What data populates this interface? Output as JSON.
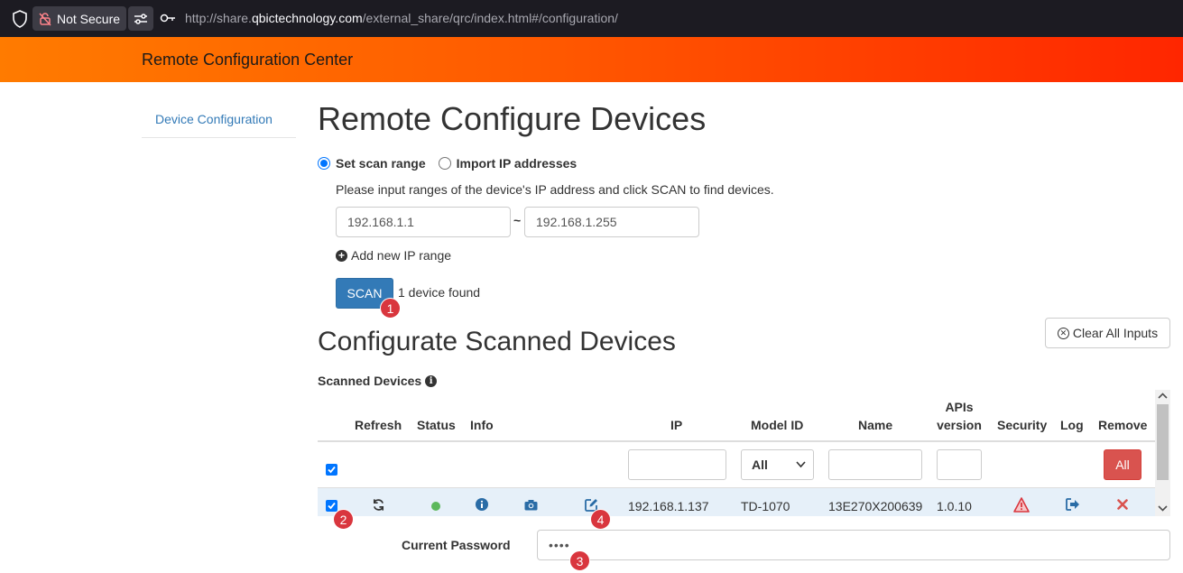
{
  "browser": {
    "not_secure_label": "Not Secure",
    "url_prefix": "http://share.",
    "url_host": "qbictechnology.com",
    "url_path": "/external_share/qrc/index.html#/configuration/"
  },
  "header": {
    "title": "Remote Configuration Center"
  },
  "sidebar": {
    "items": [
      {
        "label": "Device Configuration"
      }
    ]
  },
  "main": {
    "title": "Remote Configure Devices",
    "scan_mode": {
      "options": [
        "Set scan range",
        "Import IP addresses"
      ],
      "selected": "Set scan range"
    },
    "instructions": "Please input ranges of the device's IP address and click SCAN to find devices.",
    "ip_range": {
      "from": "192.168.1.1",
      "separator": "~",
      "to": "192.168.1.255"
    },
    "add_range_label": "Add new IP range",
    "scan_button": "SCAN",
    "scan_result": "1 device found"
  },
  "configure": {
    "title": "Configurate Scanned Devices",
    "clear_button": "Clear All Inputs",
    "scanned_label": "Scanned Devices",
    "table": {
      "headers": {
        "refresh": "Refresh",
        "status": "Status",
        "info": "Info",
        "ip": "IP",
        "model": "Model ID",
        "name": "Name",
        "apis_line1": "APIs",
        "apis_line2": "version",
        "security": "Security",
        "log": "Log",
        "remove": "Remove"
      },
      "filters": {
        "model_selected": "All",
        "remove_all_button": "All"
      },
      "rows": [
        {
          "ip": "192.168.1.137",
          "model": "TD-1070",
          "name": "13E270X200639",
          "api_version": "1.0.10",
          "checked": true,
          "status_color": "#5cb85c"
        }
      ]
    },
    "password": {
      "label": "Current Password",
      "value": "••••"
    }
  },
  "annotations": [
    "1",
    "2",
    "3",
    "4"
  ],
  "colors": {
    "header_gradient_start": "#ff7b00",
    "header_gradient_end": "#ff2600",
    "link": "#337ab7",
    "primary_button": "#337ab7",
    "danger_button": "#d9534f",
    "badge": "#d9363e",
    "row_highlight": "#e6f0f9"
  },
  "icons": [
    "shield-icon",
    "lock-slash-icon",
    "permissions-icon",
    "key-icon",
    "plus-circle-icon",
    "x-circle-icon",
    "info-circle-icon",
    "refresh-icon",
    "status-dot-icon",
    "camera-icon",
    "edit-icon",
    "warning-icon",
    "logout-icon",
    "remove-x-icon"
  ]
}
